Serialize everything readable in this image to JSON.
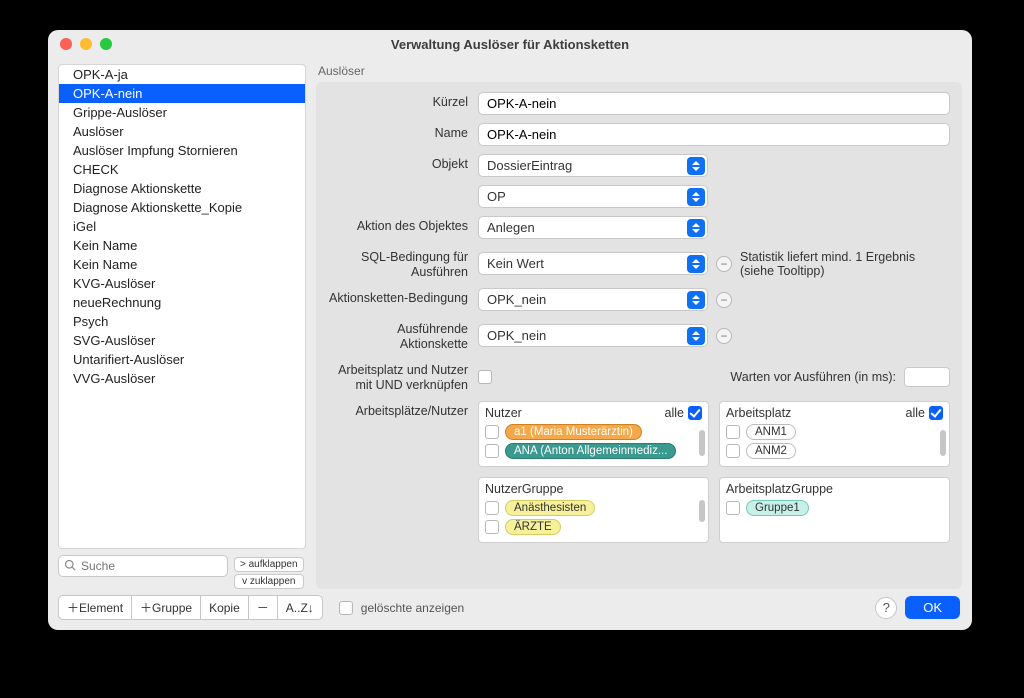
{
  "window": {
    "title": "Verwaltung Auslöser für Aktionsketten"
  },
  "sidebar": {
    "items": [
      "OPK-A-ja",
      "OPK-A-nein",
      "Grippe-Auslöser",
      "Auslöser",
      "Auslöser Impfung Stornieren",
      "CHECK",
      "Diagnose Aktionskette",
      "Diagnose Aktionskette_Kopie",
      "iGel",
      "Kein Name",
      "Kein Name",
      "KVG-Auslöser",
      "neueRechnung",
      "Psych",
      "SVG-Auslöser",
      "Untarifiert-Auslöser",
      "VVG-Auslöser"
    ],
    "selected_index": 1,
    "expand": "> aufklappen",
    "collapse": "v  zuklappen",
    "search_placeholder": "Suche"
  },
  "form": {
    "section": "Auslöser",
    "labels": {
      "kuerzel": "Kürzel",
      "name": "Name",
      "objekt": "Objekt",
      "aktion": "Aktion des Objektes",
      "sql": "SQL-Bedingung für Ausführen",
      "aktionsketten_bed": "Aktionsketten-Bedingung",
      "ausfuehrende": "Ausführende Aktionskette",
      "arbeitsplatz_und": "Arbeitsplatz und Nutzer mit UND verknüpfen",
      "warten": "Warten vor Ausführen (in ms):",
      "arbeitsnutzer": "Arbeitsplätze/Nutzer"
    },
    "values": {
      "kuerzel": "OPK-A-nein",
      "name": "OPK-A-nein",
      "objekt": "DossierEintrag",
      "objekt2": "OP",
      "aktion": "Anlegen",
      "sql": "Kein Wert",
      "aktionsketten_bed": "OPK_nein",
      "ausfuehrende": "OPK_nein"
    },
    "sql_note": "Statistik liefert mind. 1 Ergebnis (siehe Tooltipp)"
  },
  "assign": {
    "nutzer_title": "Nutzer",
    "arbeitsplatz_title": "Arbeitsplatz",
    "alle": "alle",
    "nutzer": [
      "a1 (Maria Musterärztin)",
      "ANA (Anton Allgemeinmediz..."
    ],
    "arbeitsplatz": [
      "ANM1",
      "ANM2"
    ],
    "nutzergruppe_title": "NutzerGruppe",
    "arbeitsplatzgruppe_title": "ArbeitsplatzGruppe",
    "nutzergruppe": [
      "Anästhesisten",
      "ÄRZTE"
    ],
    "arbeitsplatzgruppe": [
      "Gruppe1"
    ]
  },
  "footer": {
    "buttons": {
      "element": "＋Element",
      "gruppe": "＋Gruppe",
      "kopie": "Kopie",
      "minus": "－",
      "sort": "A..Z↓"
    },
    "deleted": "gelöschte anzeigen",
    "help": "?",
    "ok": "OK"
  },
  "colors": {
    "pill_orange_bg": "#f5a848",
    "pill_orange_br": "#d08020",
    "pill_teal_bg": "#3a9a8f",
    "pill_teal_br": "#2d7a71",
    "pill_yellow_bg": "#f6f09a",
    "pill_yellow_br": "#d4cd5e",
    "pill_gray_bg": "#ffffff",
    "pill_gray_br": "#bcbcbc",
    "pill_cyan_bg": "#c7f0e8",
    "pill_cyan_br": "#76c9b9"
  }
}
